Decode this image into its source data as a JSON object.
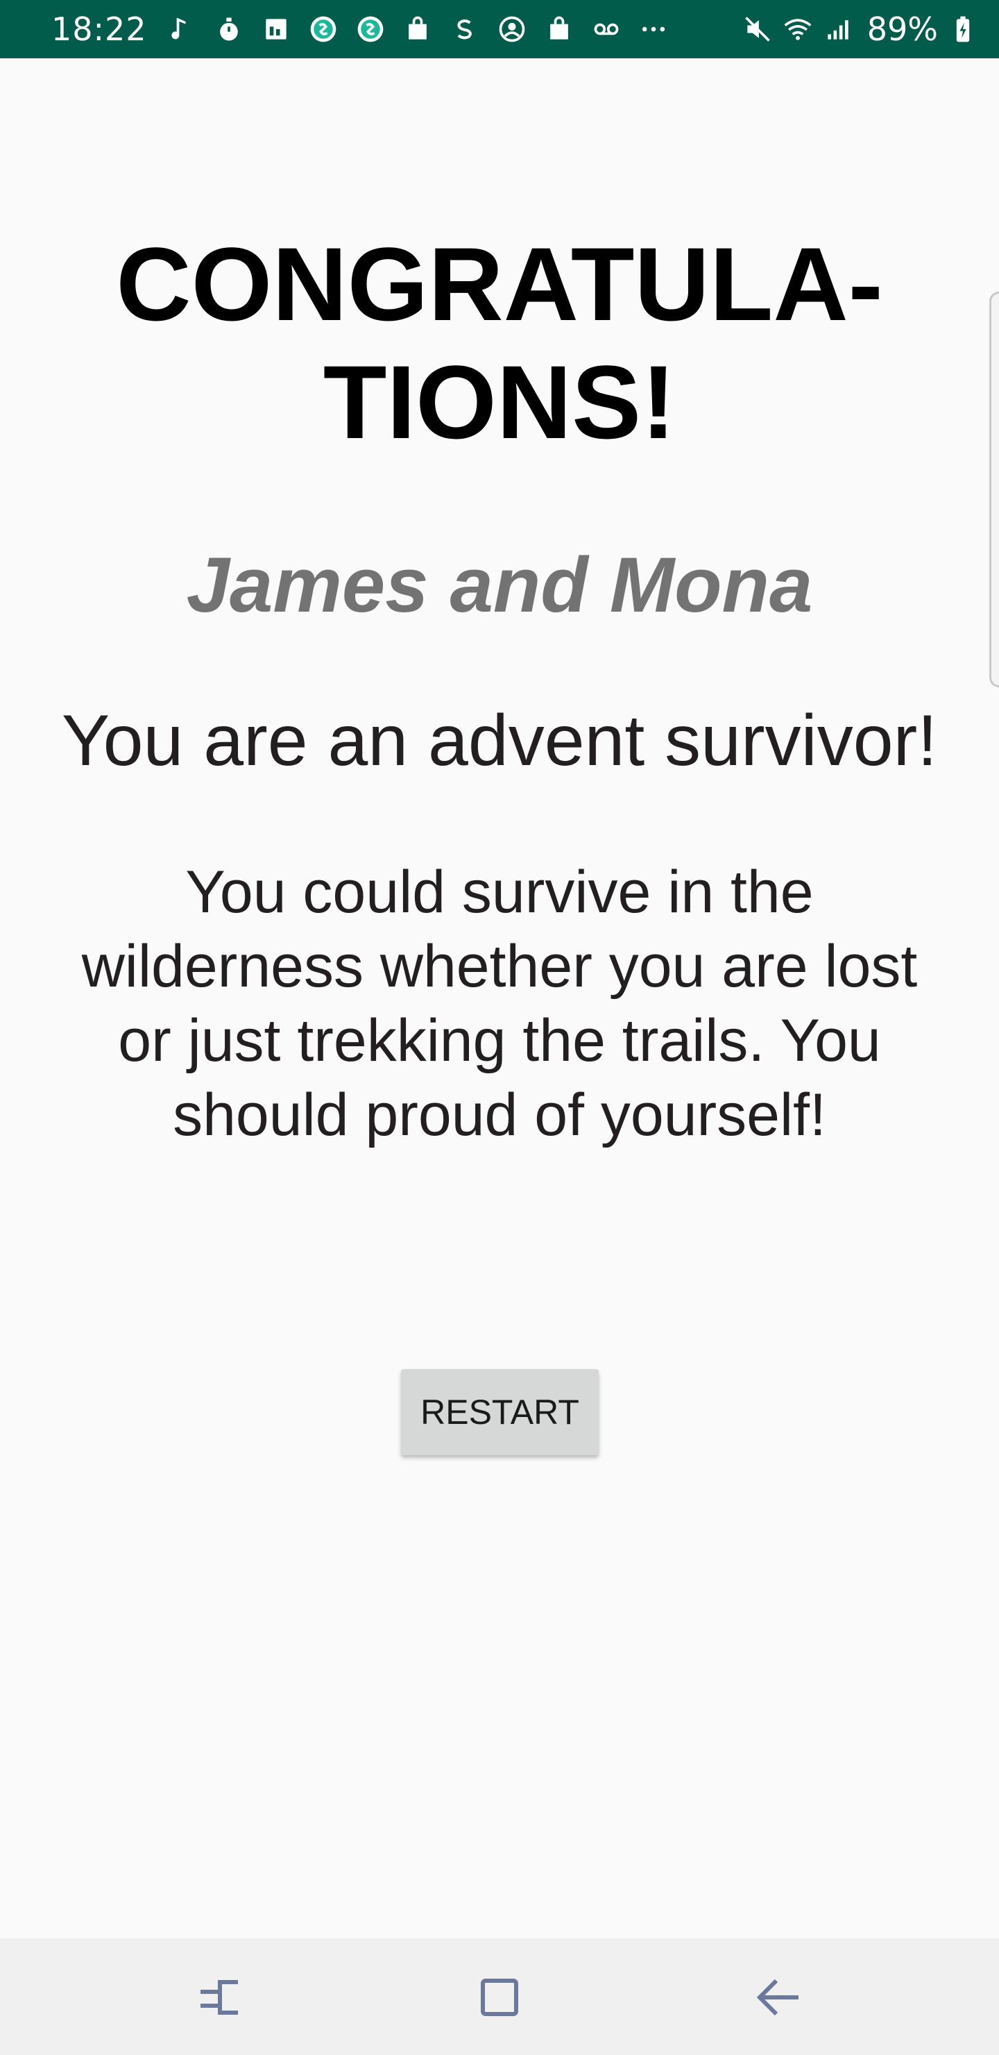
{
  "status_bar": {
    "time": "18:22",
    "battery": "89%",
    "notification_icons": [
      "music-note-icon",
      "stopwatch-icon",
      "calendar-icon",
      "shazam-icon",
      "shazam-icon",
      "shopping-bag-icon",
      "skype-icon",
      "account-icon",
      "shopping-bag-icon",
      "voicemail-icon",
      "more-dots-icon"
    ],
    "system_icons": [
      "mute-icon",
      "wifi-icon",
      "signal-icon",
      "battery-charging-icon"
    ]
  },
  "screen": {
    "title": "CONGRATULA-\nTIONS!",
    "names": "James and Mona",
    "headline": "You are an advent survivor!",
    "message": "You could survive in the wilderness whether you are lost or just trekking the trails. You should proud of yourself!",
    "restart_label": "RESTART"
  },
  "nav_bar": {
    "buttons": [
      "recent-apps-icon",
      "home-icon",
      "back-icon"
    ]
  },
  "colors": {
    "status_bar_bg": "#015c4c",
    "names_color": "#737373",
    "button_bg": "#d6d7d7"
  }
}
